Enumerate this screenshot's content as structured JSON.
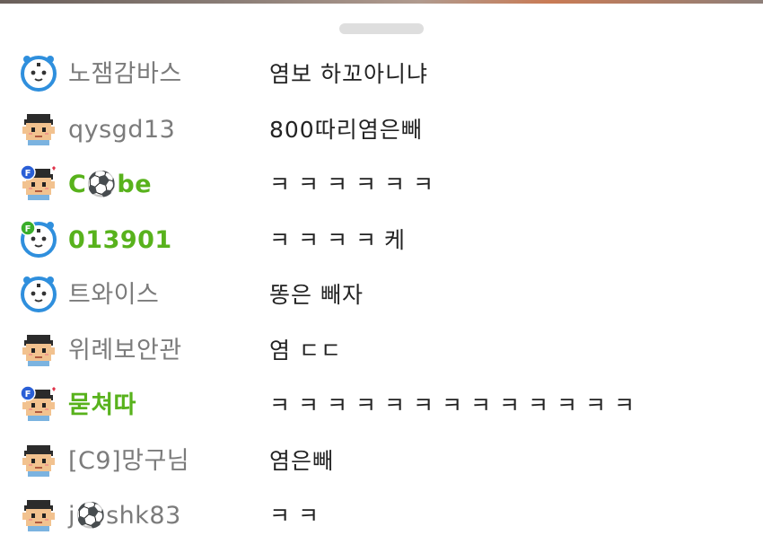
{
  "chat": {
    "messages": [
      {
        "avatar": "panda-clock-icon",
        "badge": "",
        "name": "노잼감바스",
        "message": "염보 하꼬아니냐",
        "fan": false
      },
      {
        "avatar": "pixel-boy-icon",
        "badge": "",
        "name": "qysgd13",
        "message": "800따리염은빼",
        "fan": false
      },
      {
        "avatar": "pixel-boy-icon",
        "badge": "fan-badge-blue",
        "name": "C⚽be",
        "message": "ㅋㅋㅋㅋㅋㅋ",
        "fan": true
      },
      {
        "avatar": "panda-clock-icon",
        "badge": "fan-badge-green",
        "name": "013901",
        "message": "ㅋㅋㅋㅋ케",
        "fan": true
      },
      {
        "avatar": "panda-clock-icon",
        "badge": "",
        "name": "트와이스",
        "message": "똥은 빼자",
        "fan": false
      },
      {
        "avatar": "pixel-boy-icon",
        "badge": "",
        "name": "위례보안관",
        "message": "염 ㄷㄷ",
        "fan": false
      },
      {
        "avatar": "pixel-boy-icon",
        "badge": "fan-badge-blue",
        "name": "묻쳐따",
        "message": "ㅋㅋㅋㅋㅋㅋㅋㅋㅋㅋㅋㅋㅋ",
        "fan": true
      },
      {
        "avatar": "pixel-boy-icon",
        "badge": "",
        "name": "[C9]망구님",
        "message": "염은빼",
        "fan": false
      },
      {
        "avatar": "pixel-boy-icon",
        "badge": "",
        "name": "j⚽shk83",
        "message": "ㅋㅋ",
        "fan": false
      }
    ]
  },
  "colors": {
    "fan_name": "#58b21c",
    "normal_name": "#7b7b7b",
    "message_text": "#222222",
    "handle": "#dedede"
  }
}
